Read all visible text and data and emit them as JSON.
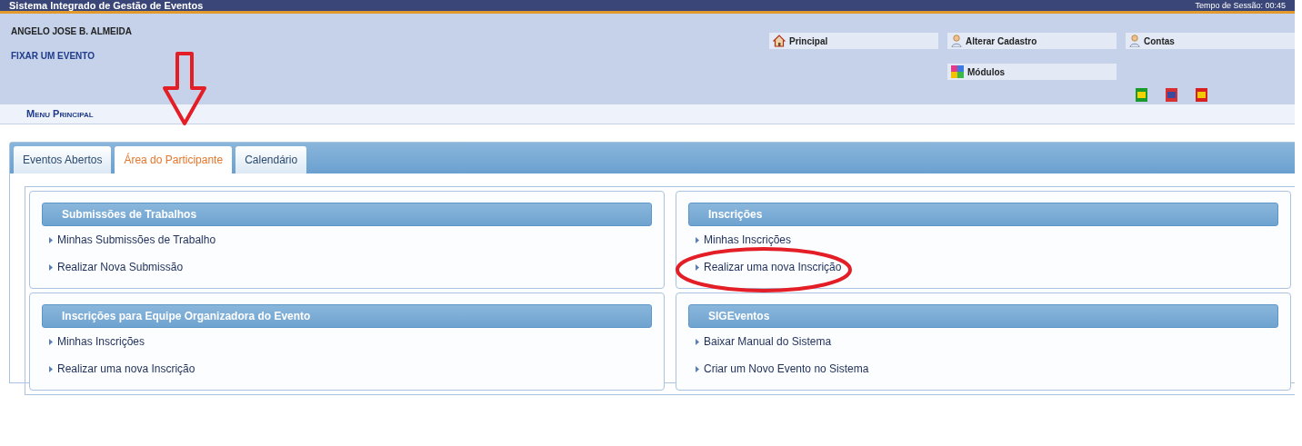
{
  "header": {
    "title": "Sistema Integrado de Gestão de Eventos",
    "session": "Tempo de Sessão: 00:45",
    "user": "ANGELO JOSE B. ALMEIDA",
    "link": "FIXAR UM EVENTO"
  },
  "shortcuts": [
    {
      "label": "Principal"
    },
    {
      "label": "Alterar Cadastro"
    },
    {
      "label": "Contas"
    },
    {
      "label": "Módulos"
    }
  ],
  "menu_title": "Menu Principal",
  "tabs": [
    {
      "label": "Eventos Abertos",
      "selected": false
    },
    {
      "label": "Área do Participante",
      "selected": true
    },
    {
      "label": "Calendário",
      "selected": false
    }
  ],
  "sections": [
    {
      "title": "Submissões de Trabalhos",
      "links": [
        "Minhas Submissões de Trabalho",
        "Realizar Nova Submissão"
      ]
    },
    {
      "title": "Inscrições",
      "links": [
        "Minhas Inscrições",
        "Realizar uma nova Inscrição"
      ]
    },
    {
      "title": "Inscrições para Equipe Organizadora do Evento",
      "links": [
        "Minhas Inscrições",
        "Realizar uma nova Inscrição"
      ]
    },
    {
      "title": "SIGEventos",
      "links": [
        "Baixar Manual do Sistema",
        "Criar um Novo Evento no Sistema"
      ]
    }
  ]
}
